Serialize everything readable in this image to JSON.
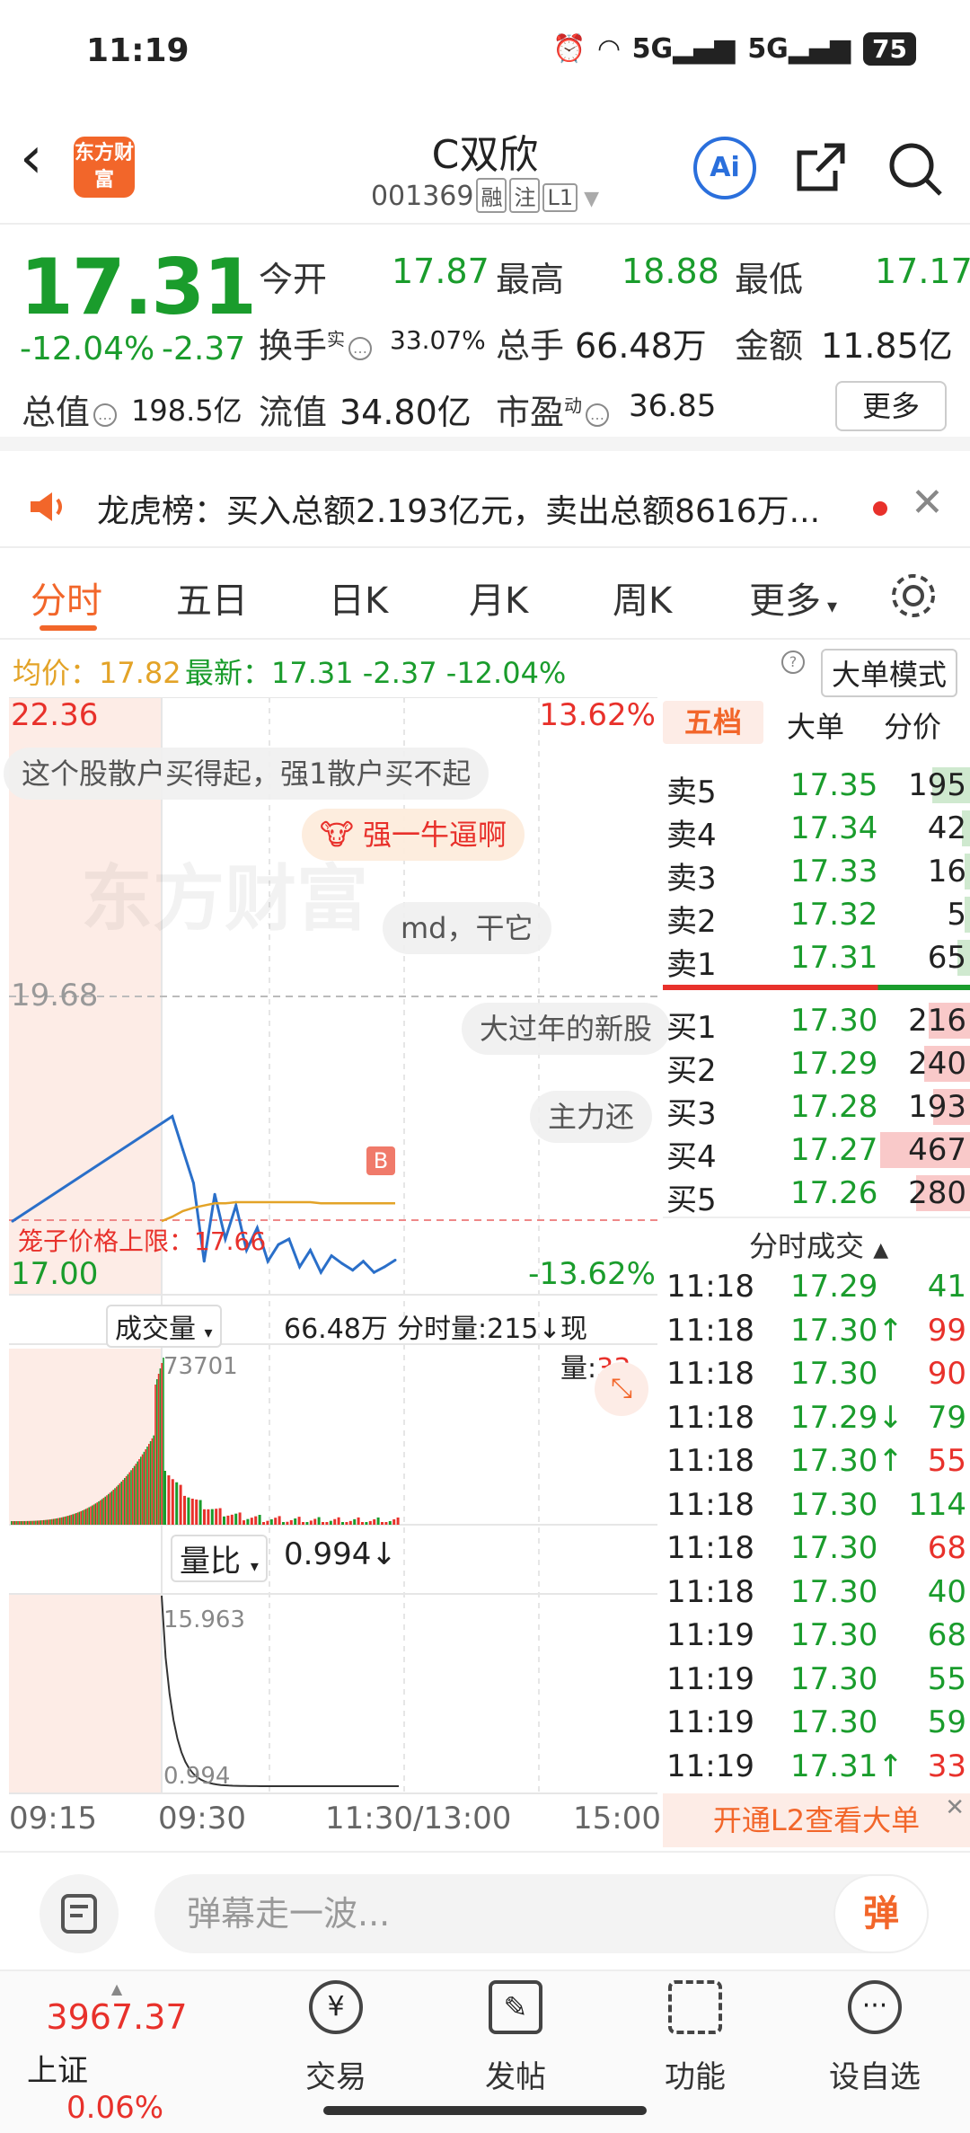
{
  "status_bar": {
    "time": "11:19",
    "signal1": "5G",
    "signal2": "5G",
    "battery": "75"
  },
  "header": {
    "logo_text": "东方财富",
    "title": "C双欣",
    "code": "001369",
    "tags": [
      "融",
      "注",
      "L1"
    ],
    "ai_label": "Ai"
  },
  "quote": {
    "price": "17.31",
    "change_pct": "-12.04%",
    "change": "-2.37",
    "open_label": "今开",
    "open": "17.87",
    "high_label": "最高",
    "high": "18.88",
    "low_label": "最低",
    "low": "17.17",
    "turnover_label": "换手",
    "turnover_sup": "实",
    "turnover": "33.07%",
    "volume_label": "总手",
    "volume": "66.48万",
    "amount_label": "金额",
    "amount": "11.85亿",
    "mcap_label": "总值",
    "mcap": "198.5亿",
    "float_label": "流值",
    "float": "34.80亿",
    "pe_label": "市盈",
    "pe_sup": "动",
    "pe": "36.85",
    "more_label": "更多"
  },
  "news": {
    "text": "龙虎榜：买入总额2.193亿元，卖出总额8616万..."
  },
  "tabs": [
    "分时",
    "五日",
    "日K",
    "月K",
    "周K",
    "更多"
  ],
  "avg_line": {
    "avg_label": "均价：",
    "avg": "17.82",
    "latest_label": "最新：",
    "latest": "17.31",
    "latest_chg": "-2.37",
    "latest_pct": "-12.04%",
    "mode": "大单模式"
  },
  "chart": {
    "top_price": "22.36",
    "top_pct": "13.62%",
    "ref_price": "19.68",
    "bottom_price": "17.00",
    "bottom_pct": "-13.62%",
    "limit_label": "笼子价格上限：17.66",
    "b_marker": "B",
    "vol_label": "成交量",
    "vol_total": "66.48万",
    "vol_minute": "分时量:215↓",
    "vol_now_label": "现量:",
    "vol_now": "33",
    "vol_max": "73701",
    "ratio_label": "量比",
    "ratio": "0.994↓",
    "ratio_max": "15.963",
    "ratio_min": "0.994",
    "time_axis": [
      "09:15",
      "09:30",
      "11:30/13:00",
      "15:00"
    ],
    "watermark": "东方财富"
  },
  "chart_data": {
    "type": "line",
    "title": "",
    "xlabel": "",
    "ylabel": "",
    "x": [
      "09:30",
      "09:35",
      "09:40",
      "09:45",
      "09:50",
      "09:55",
      "10:00",
      "10:05",
      "10:10",
      "10:15",
      "10:20",
      "10:25",
      "10:30",
      "10:35",
      "10:40",
      "10:45",
      "10:50",
      "10:55",
      "11:00",
      "11:05",
      "11:10",
      "11:15",
      "11:19"
    ],
    "series": [
      {
        "name": "",
        "values": [
          17.66,
          18.6,
          18.3,
          18.0,
          17.3,
          17.9,
          17.5,
          17.8,
          17.4,
          17.6,
          17.3,
          17.45,
          17.5,
          17.25,
          17.4,
          17.2,
          17.35,
          17.28,
          17.22,
          17.3,
          17.2,
          17.25,
          17.31
        ]
      },
      {
        "name": "",
        "values": [
          17.66,
          17.7,
          17.75,
          17.78,
          17.8,
          17.82,
          17.82,
          17.83,
          17.83,
          17.83,
          17.83,
          17.83,
          17.83,
          17.83,
          17.83,
          17.82,
          17.82,
          17.82,
          17.82,
          17.82,
          17.82,
          17.82,
          17.82
        ]
      }
    ],
    "ylim": [
      17.0,
      22.36
    ]
  },
  "danmu": [
    "这个股散户买得起，强1散户买不起",
    "强一牛逼啊",
    "md，干它",
    "大过年的新股",
    "主力还"
  ],
  "order_book": {
    "tabs": [
      "五档",
      "大单",
      "分价"
    ],
    "asks": [
      {
        "label": "卖5",
        "price": "17.35",
        "vol": "195"
      },
      {
        "label": "卖4",
        "price": "17.34",
        "vol": "42"
      },
      {
        "label": "卖3",
        "price": "17.33",
        "vol": "16"
      },
      {
        "label": "卖2",
        "price": "17.32",
        "vol": "5"
      },
      {
        "label": "卖1",
        "price": "17.31",
        "vol": "65"
      }
    ],
    "bids": [
      {
        "label": "买1",
        "price": "17.30",
        "vol": "216"
      },
      {
        "label": "买2",
        "price": "17.29",
        "vol": "240"
      },
      {
        "label": "买3",
        "price": "17.28",
        "vol": "193"
      },
      {
        "label": "买4",
        "price": "17.27",
        "vol": "467"
      },
      {
        "label": "买5",
        "price": "17.26",
        "vol": "280"
      }
    ],
    "trades_title": "分时成交",
    "trades": [
      {
        "t": "11:18",
        "p": "17.29",
        "v": "41",
        "c": "green"
      },
      {
        "t": "11:18",
        "p": "17.30↑",
        "v": "99",
        "c": "red"
      },
      {
        "t": "11:18",
        "p": "17.30",
        "v": "90",
        "c": "red"
      },
      {
        "t": "11:18",
        "p": "17.29↓",
        "v": "79",
        "c": "green"
      },
      {
        "t": "11:18",
        "p": "17.30↑",
        "v": "55",
        "c": "red"
      },
      {
        "t": "11:18",
        "p": "17.30",
        "v": "114",
        "c": "green"
      },
      {
        "t": "11:18",
        "p": "17.30",
        "v": "68",
        "c": "red"
      },
      {
        "t": "11:18",
        "p": "17.30",
        "v": "40",
        "c": "green"
      },
      {
        "t": "11:19",
        "p": "17.30",
        "v": "68",
        "c": "green"
      },
      {
        "t": "11:19",
        "p": "17.30",
        "v": "55",
        "c": "green"
      },
      {
        "t": "11:19",
        "p": "17.30",
        "v": "59",
        "c": "green"
      },
      {
        "t": "11:19",
        "p": "17.31↑",
        "v": "33",
        "c": "red"
      }
    ],
    "l2_banner": "开通L2查看大单"
  },
  "input_bar": {
    "placeholder": "弹幕走一波...",
    "button": "弹"
  },
  "bottom_nav": {
    "index_value": "3967.37",
    "index_name": "上证",
    "index_pct": "0.06%",
    "items": [
      "交易",
      "发帖",
      "功能",
      "设自选"
    ]
  },
  "colors": {
    "accent": "#f2662a",
    "up": "#e8312b",
    "down": "#1a9c2c",
    "price_line": "#2a6fc9",
    "avg_line": "#e3a327"
  }
}
